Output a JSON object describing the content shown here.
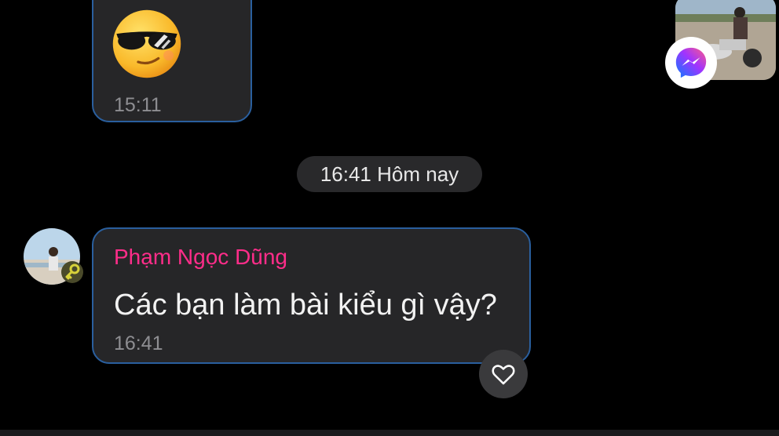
{
  "messages": [
    {
      "type": "emoji",
      "emoji_icon": "smiling-face-with-sunglasses",
      "time": "15:11"
    },
    {
      "type": "text",
      "sender": "Phạm Ngọc Dũng",
      "text": "Các bạn làm bài kiểu gì vậy?",
      "time": "16:41",
      "reaction_icon": "heart-outline"
    }
  ],
  "date_separator": "16:41 Hôm nay",
  "overlay": {
    "app_icon": "messenger-icon"
  },
  "colors": {
    "background": "#000000",
    "bubble": "#262628",
    "bubble_border": "#2a5f9e",
    "sender_name": "#ff2d8a",
    "timestamp": "#8e8e92"
  }
}
